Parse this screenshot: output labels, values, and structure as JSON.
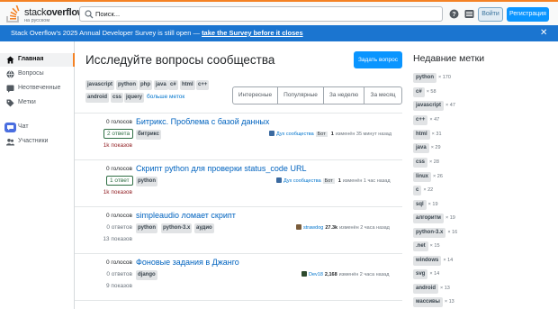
{
  "topbar": {
    "logo_main": "stack",
    "logo_bold": "overflow",
    "logo_sub": "на русском",
    "search_placeholder": "Поиск...",
    "login_label": "Войти",
    "register_label": "Регистрация",
    "accent": "#f48225"
  },
  "banner": {
    "text": "Stack Overflow’s 2025 Annual Developer Survey is still open —",
    "link": "take the Survey before it closes",
    "close": "✕",
    "color": "#1b75d0"
  },
  "leftnav": {
    "items": [
      {
        "label": "Главная",
        "icon": "home-icon",
        "active": true
      },
      {
        "label": "Вопросы",
        "icon": "globe-icon",
        "active": false
      },
      {
        "label": "Неотвеченные",
        "icon": "unanswered-icon",
        "active": false
      },
      {
        "label": "Метки",
        "icon": "tag-icon",
        "active": false
      },
      {
        "label": "Чат",
        "icon": "chat-icon",
        "active": false
      },
      {
        "label": "Участники",
        "icon": "users-icon",
        "active": false
      }
    ]
  },
  "main": {
    "title": "Исследуйте вопросы сообщества",
    "ask_button": "Задать вопрос",
    "tags_row1": [
      "javascript",
      "python",
      "php",
      "java",
      "c#",
      "html",
      "c++"
    ],
    "tags_row2": [
      "android",
      "css",
      "jquery"
    ],
    "more_tags": "больше меток",
    "filters": [
      "Интересные",
      "Популярные",
      "За неделю",
      "За месяц"
    ],
    "questions": [
      {
        "votes": "0 голосов",
        "answers": "2 ответа",
        "answers_boxed": true,
        "views": "1k показов",
        "title": "Битрикс. Проблема с базой данных",
        "tags": [
          "битрикс"
        ],
        "user": "Дух сообщества",
        "bot": "Бот",
        "rep": "1",
        "time": "изменён 35 минут назад"
      },
      {
        "votes": "0 голосов",
        "answers": "1 ответ",
        "answers_boxed": true,
        "views": "1k показов",
        "title": "Скрипт python для проверки status_code URL",
        "tags": [
          "python"
        ],
        "user": "Дух сообщества",
        "bot": "Бот",
        "rep": "1",
        "time": "изменён 1 час назад"
      },
      {
        "votes": "0 голосов",
        "answers": "0 ответов",
        "answers_boxed": false,
        "views": "13 показов",
        "title": "simpleaudio ломает скрипт",
        "tags": [
          "python",
          "python-3.x",
          "аудио"
        ],
        "user": "strawdog",
        "bot": "",
        "rep": "27.3k",
        "time": "изменён 2 часа назад"
      },
      {
        "votes": "0 голосов",
        "answers": "0 ответов",
        "answers_boxed": false,
        "views": "9 показов",
        "title": "Фоновые задания в Джанго",
        "tags": [
          "django"
        ],
        "user": "Dev18",
        "bot": "",
        "rep": "2,168",
        "time": "изменён 2 часа назад"
      }
    ]
  },
  "rside": {
    "title": "Недавние метки",
    "tags": [
      {
        "name": "python",
        "count": "× 170"
      },
      {
        "name": "c#",
        "count": "× 58"
      },
      {
        "name": "javascript",
        "count": "× 47"
      },
      {
        "name": "c++",
        "count": "× 47"
      },
      {
        "name": "html",
        "count": "× 31"
      },
      {
        "name": "java",
        "count": "× 29"
      },
      {
        "name": "css",
        "count": "× 28"
      },
      {
        "name": "linux",
        "count": "× 26"
      },
      {
        "name": "c",
        "count": "× 22"
      },
      {
        "name": "sql",
        "count": "× 19"
      },
      {
        "name": "алгоритм",
        "count": "× 19"
      },
      {
        "name": "python-3.x",
        "count": "× 16"
      },
      {
        "name": ".net",
        "count": "× 15"
      },
      {
        "name": "windows",
        "count": "× 14"
      },
      {
        "name": "svg",
        "count": "× 14"
      },
      {
        "name": "android",
        "count": "× 13"
      },
      {
        "name": "массивы",
        "count": "× 13"
      }
    ]
  }
}
